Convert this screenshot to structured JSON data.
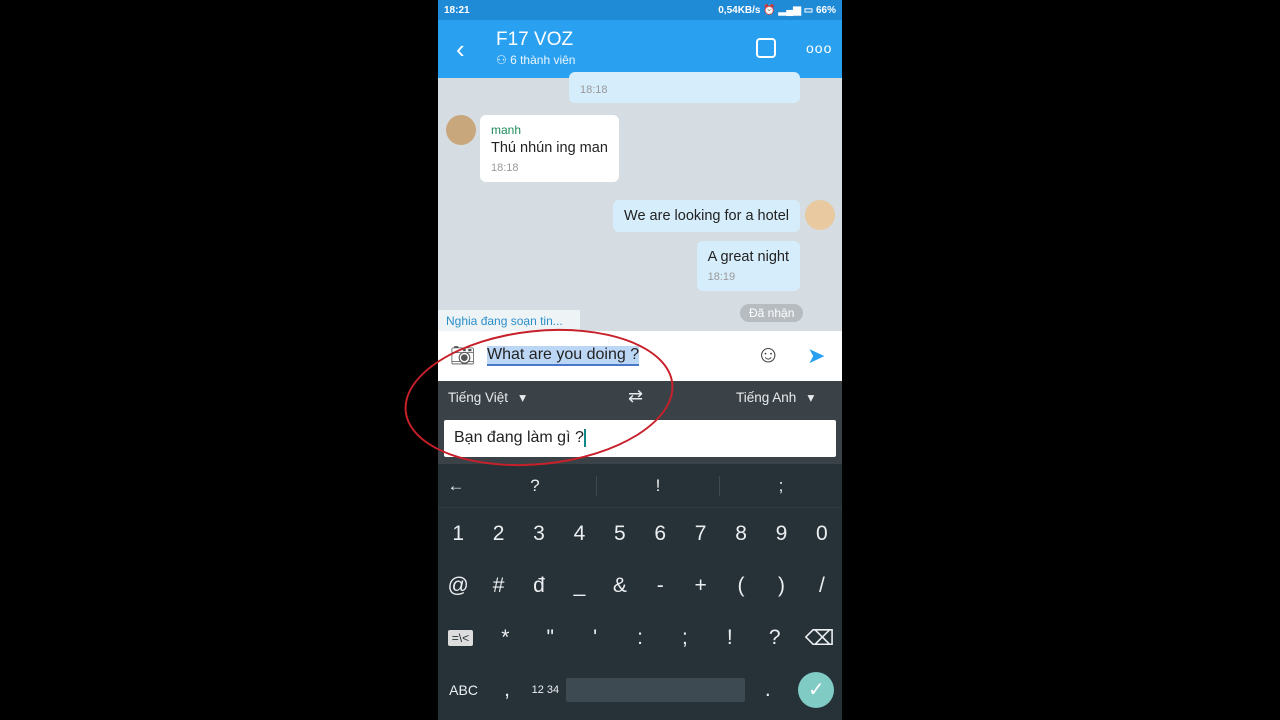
{
  "status": {
    "time": "18:21",
    "network": "0,54KB/s",
    "battery": "66%"
  },
  "header": {
    "title": "F17 VOZ",
    "members": "6 thành viên"
  },
  "messages": [
    {
      "time": "18:18"
    },
    {
      "sender": "manh",
      "text": "Thú nhún ing man",
      "time": "18:18"
    },
    {
      "text": "We are looking for a hotel"
    },
    {
      "text": "A great night",
      "time": "18:19"
    }
  ],
  "typing": "Nghia đang soạn tin...",
  "received": "Đã nhận",
  "input": {
    "value": "What are you doing ?"
  },
  "translator": {
    "source_lang": "Tiếng Việt",
    "target_lang": "Tiếng Anh",
    "result": "Bạn đang làm gì ?"
  },
  "keyboard": {
    "suggestions": [
      "?",
      "!",
      ";"
    ],
    "row1": [
      "1",
      "2",
      "3",
      "4",
      "5",
      "6",
      "7",
      "8",
      "9",
      "0"
    ],
    "row2": [
      "@",
      "#",
      "đ",
      "_",
      "&",
      "-",
      "+",
      "(",
      ")",
      "/"
    ],
    "row3": [
      "=\\<",
      "*",
      "\"",
      "'",
      ":",
      ";",
      "!",
      "?"
    ],
    "row4": {
      "abc": "ABC",
      "comma": ",",
      "num": "12 34",
      "period": "."
    }
  },
  "colors": {
    "header": "#2aa0f0",
    "keyboard": "#263238",
    "annotation": "#c8202a"
  }
}
